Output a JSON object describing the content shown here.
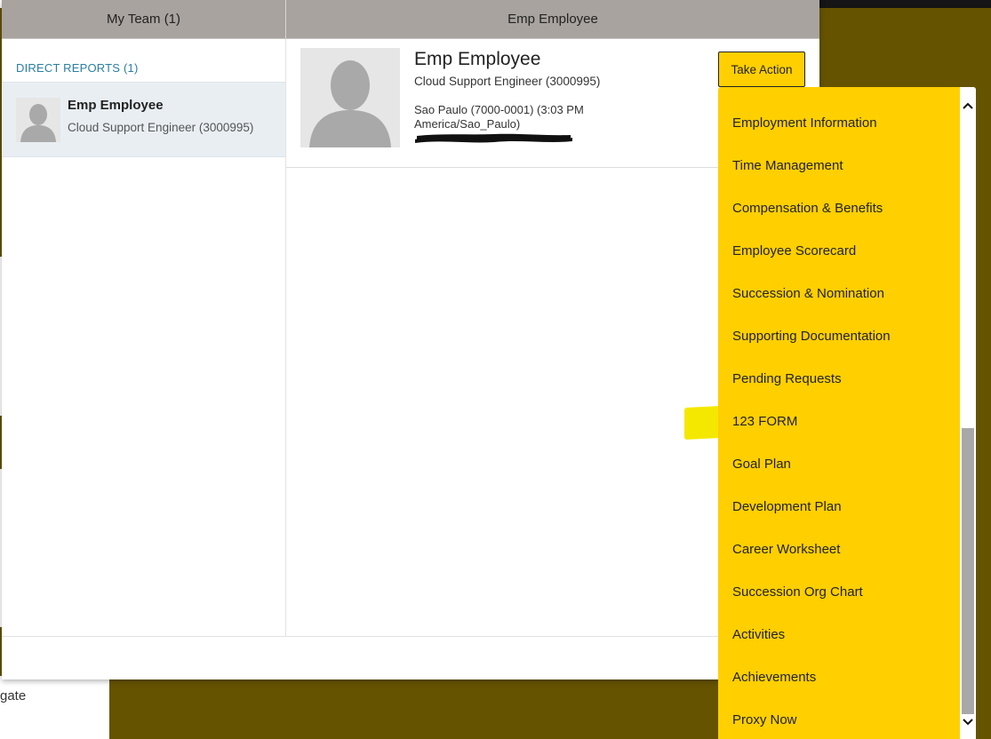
{
  "background": {
    "left_text": "gate"
  },
  "left_header": {
    "title": "My Team (1)"
  },
  "right_header": {
    "title": "Emp Employee"
  },
  "direct_reports": {
    "label": "DIRECT REPORTS (1)",
    "items": [
      {
        "name": "Emp Employee",
        "title": "Cloud Support Engineer (3000995)"
      }
    ]
  },
  "profile": {
    "name": "Emp Employee",
    "title": "Cloud Support Engineer (3000995)",
    "location": "Sao Paulo (7000-0001) (3:03 PM America/Sao_Paulo)"
  },
  "take_action": {
    "label": "Take Action"
  },
  "menu": {
    "items": [
      "Employment Information",
      "Time Management",
      "Compensation & Benefits",
      "Employee Scorecard",
      "Succession & Nomination",
      "Supporting Documentation",
      "Pending Requests",
      "123 FORM",
      "Goal Plan",
      "Development Plan",
      "Career Worksheet",
      "Succession Org Chart",
      "Activities",
      "Achievements",
      "Proxy Now"
    ]
  },
  "colors": {
    "accent": "#ffcf00",
    "backdrop": "#655300",
    "header": "#a8a39f",
    "link": "#2a7ea5"
  }
}
